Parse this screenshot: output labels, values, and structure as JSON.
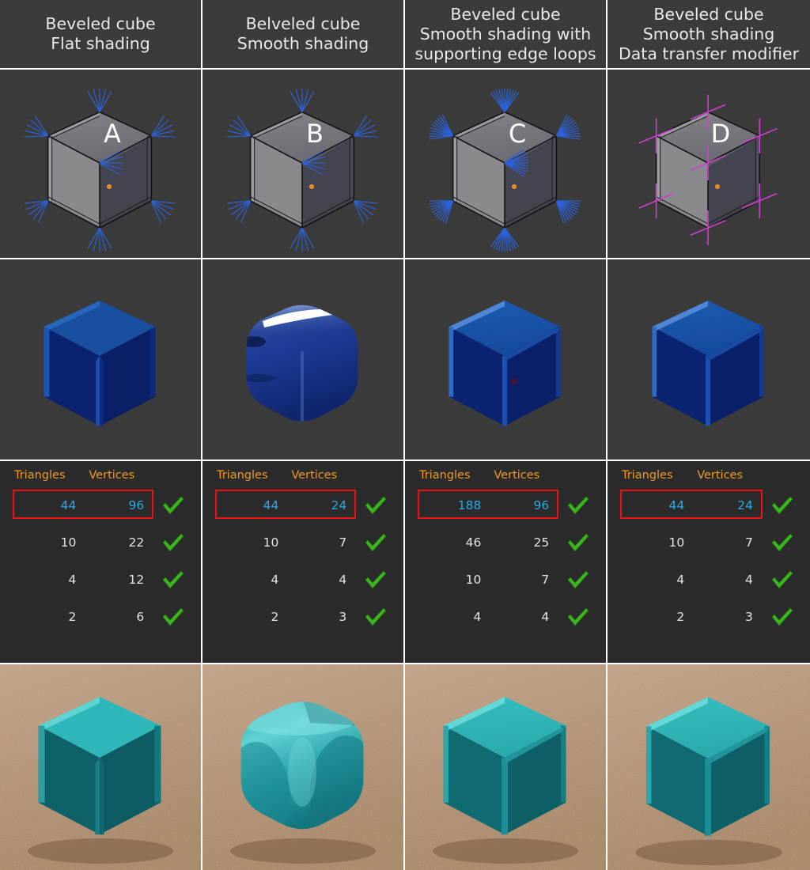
{
  "figure": {
    "title": "Beveled cube shading comparison",
    "columns": [
      {
        "id": "A",
        "letter": "A",
        "heading_lines": [
          "Beveled cube",
          "Flat shading"
        ],
        "normals_color": "#2b62d9",
        "normals_style": "short-fan",
        "viewport_label": "A",
        "render_style": "flat-faceted",
        "render_color": "#0f3fa0",
        "teal_style": "flat-faceted",
        "teal_color": "#2aa9ae",
        "origin_dot": "#e08a28",
        "stats": {
          "headers": [
            "Triangles",
            "Vertices",
            ""
          ],
          "rows": [
            {
              "triangles": "44",
              "vertices": "96",
              "check": "checkmark-icon",
              "highlighted": true
            },
            {
              "triangles": "10",
              "vertices": "22",
              "check": "checkmark-icon",
              "highlighted": false
            },
            {
              "triangles": "4",
              "vertices": "12",
              "check": "checkmark-icon",
              "highlighted": false
            },
            {
              "triangles": "2",
              "vertices": "6",
              "check": "checkmark-icon",
              "highlighted": false
            }
          ]
        }
      },
      {
        "id": "B",
        "letter": "B",
        "heading_lines": [
          "Belveled cube",
          "Smooth shading"
        ],
        "normals_color": "#2b62d9",
        "normals_style": "short-fan",
        "viewport_label": "B",
        "render_style": "glossy-smeared",
        "render_color": "#16388f",
        "teal_style": "pillow-smooth",
        "teal_color": "#34bfc2",
        "origin_dot": "#e08a28",
        "stats": {
          "headers": [
            "Triangles",
            "Vertices",
            ""
          ],
          "rows": [
            {
              "triangles": "44",
              "vertices": "24",
              "check": "checkmark-icon",
              "highlighted": true
            },
            {
              "triangles": "10",
              "vertices": "7",
              "check": "checkmark-icon",
              "highlighted": false
            },
            {
              "triangles": "4",
              "vertices": "4",
              "check": "checkmark-icon",
              "highlighted": false
            },
            {
              "triangles": "2",
              "vertices": "3",
              "check": "checkmark-icon",
              "highlighted": false
            }
          ]
        }
      },
      {
        "id": "C",
        "letter": "C",
        "heading_lines": [
          "Beveled cube",
          "Smooth shading with",
          "supporting edge loops"
        ],
        "normals_color": "#2b62d9",
        "normals_style": "dense-fan",
        "viewport_label": "C",
        "render_style": "smooth-correct",
        "render_color": "#0f3fa0",
        "teal_style": "smooth-correct",
        "teal_color": "#2aa9ae",
        "origin_dot": "#e08a28",
        "stats": {
          "headers": [
            "Triangles",
            "Vertices",
            ""
          ],
          "rows": [
            {
              "triangles": "188",
              "vertices": "96",
              "check": "checkmark-icon",
              "highlighted": true
            },
            {
              "triangles": "46",
              "vertices": "25",
              "check": "checkmark-icon",
              "highlighted": false
            },
            {
              "triangles": "10",
              "vertices": "7",
              "check": "checkmark-icon",
              "highlighted": false
            },
            {
              "triangles": "4",
              "vertices": "4",
              "check": "checkmark-icon",
              "highlighted": false
            }
          ]
        }
      },
      {
        "id": "D",
        "letter": "D",
        "heading_lines": [
          "Beveled cube",
          "Smooth shading",
          "Data transfer modifier"
        ],
        "normals_color": "#d040d0",
        "normals_style": "cross",
        "viewport_label": "D",
        "render_style": "smooth-correct",
        "render_color": "#0f3fa0",
        "teal_style": "smooth-correct",
        "teal_color": "#2aa9ae",
        "origin_dot": "#e08a28",
        "stats": {
          "headers": [
            "Triangles",
            "Vertices",
            ""
          ],
          "rows": [
            {
              "triangles": "44",
              "vertices": "24",
              "check": "checkmark-icon",
              "highlighted": true
            },
            {
              "triangles": "10",
              "vertices": "7",
              "check": "checkmark-icon",
              "highlighted": false
            },
            {
              "triangles": "4",
              "vertices": "4",
              "check": "checkmark-icon",
              "highlighted": false
            },
            {
              "triangles": "2",
              "vertices": "3",
              "check": "checkmark-icon",
              "highlighted": false
            }
          ]
        }
      }
    ],
    "colors": {
      "panel_background": "#3b3b3b",
      "table_background": "#2b2b2b",
      "separator": "#ffffff",
      "header_text": "#e9e9e9",
      "column_header_text": "#ee9a1e",
      "value_text": "#e4e4e4",
      "highlight_text": "#29abe2",
      "highlight_box": "#ee1111",
      "check_green": "#3cb521",
      "normal_blue": "#2b62d9",
      "normal_magenta": "#d040d0",
      "origin_orange": "#e08a28",
      "render_blue": "#0f3fa0",
      "render_teal": "#2aa9ae",
      "ground_tan": "#b99477"
    }
  }
}
